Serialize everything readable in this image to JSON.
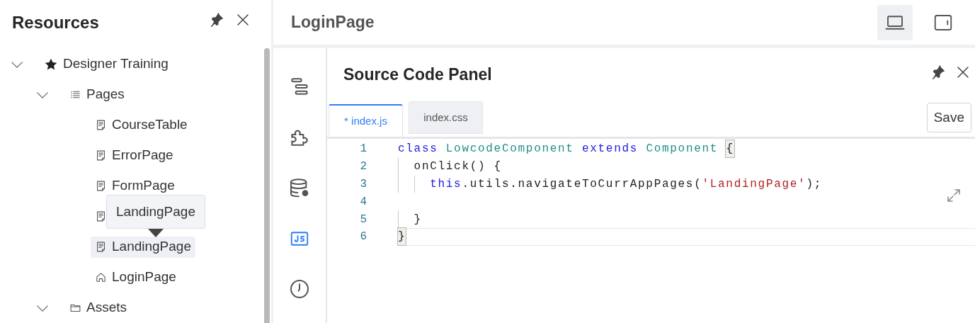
{
  "resources": {
    "title": "Resources"
  },
  "tree": [
    {
      "label": "Designer Training",
      "kind": "star",
      "expanded": true,
      "children": [
        {
          "label": "Pages",
          "kind": "list",
          "expanded": true,
          "children": [
            {
              "label": "CourseTable",
              "kind": "page",
              "selected": false
            },
            {
              "label": "ErrorPage",
              "kind": "page",
              "selected": false
            },
            {
              "label": "FormPage",
              "kind": "page",
              "selected": false
            },
            {
              "kind": "page",
              "selected": false
            },
            {
              "label": "LandingPage",
              "kind": "page",
              "selected": true
            },
            {
              "label": "LoginPage",
              "kind": "home",
              "selected": false
            }
          ]
        },
        {
          "label": "Assets",
          "kind": "folder",
          "expanded": true
        }
      ]
    }
  ],
  "tooltip": {
    "text": "LandingPage"
  },
  "page_header": {
    "title": "LoginPage",
    "devices": [
      {
        "kind": "laptop",
        "selected": true
      },
      {
        "kind": "tablet",
        "selected": false
      }
    ]
  },
  "rail": [
    {
      "kind": "outline",
      "selected": false
    },
    {
      "kind": "component",
      "selected": false
    },
    {
      "kind": "datasource",
      "selected": false
    },
    {
      "kind": "js",
      "selected": true
    },
    {
      "kind": "history",
      "selected": false
    }
  ],
  "panel": {
    "title": "Source Code Panel",
    "tabs": [
      {
        "label": "* index.js",
        "selected": true
      },
      {
        "label": "index.css",
        "selected": false
      }
    ],
    "save": "Save",
    "code": [
      {
        "number": "1",
        "tokens": [
          {
            "text": "class ",
            "kind": "keyword"
          },
          {
            "text": "LowcodeComponent ",
            "kind": "type"
          },
          {
            "text": "extends ",
            "kind": "keyword"
          },
          {
            "text": "Component ",
            "kind": "type"
          },
          {
            "text": "{",
            "kind": "match"
          }
        ]
      },
      {
        "number": "2",
        "tokens": [
          {
            "text": "  onClick() {",
            "kind": "plain"
          }
        ]
      },
      {
        "number": "3",
        "tokens": [
          {
            "text": "    this",
            "kind": "keyword"
          },
          {
            "text": ".utils.navigateToCurrAppPages(",
            "kind": "plain"
          },
          {
            "text": "'LandingPage'",
            "kind": "string"
          },
          {
            "text": ");",
            "kind": "plain"
          }
        ]
      },
      {
        "number": "4"
      },
      {
        "number": "5",
        "tokens": [
          {
            "text": "  }",
            "kind": "plain"
          }
        ]
      },
      {
        "number": "6",
        "current": true,
        "tokens": [
          {
            "text": "}",
            "kind": "match"
          }
        ]
      }
    ]
  }
}
